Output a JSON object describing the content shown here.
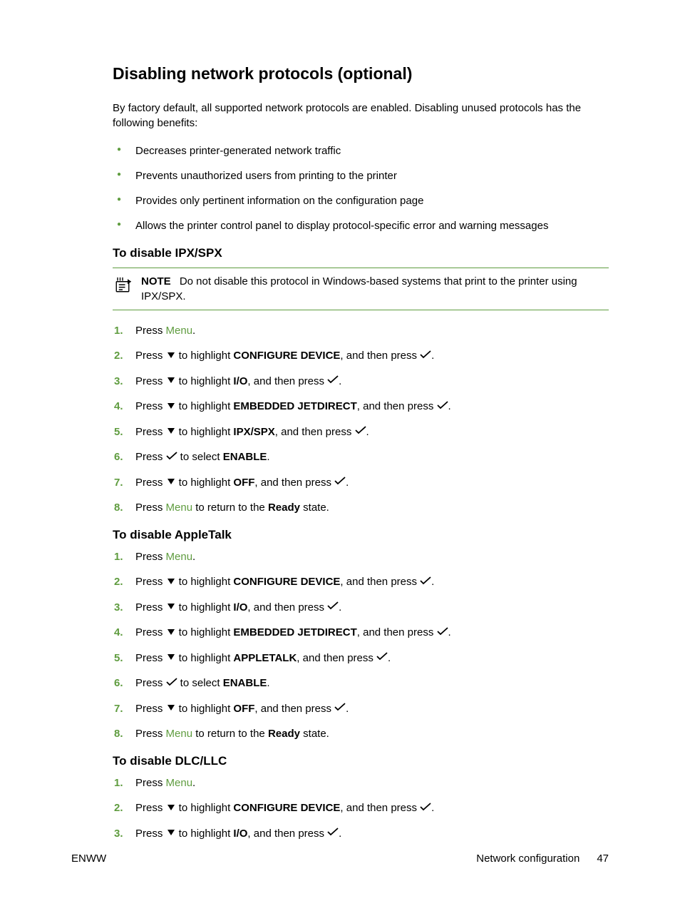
{
  "heading": "Disabling network protocols (optional)",
  "intro": "By factory default, all supported network protocols are enabled. Disabling unused protocols has the following benefits:",
  "bullets": [
    "Decreases printer-generated network traffic",
    "Prevents unauthorized users from printing to the printer",
    "Provides only pertinent information on the configuration page",
    "Allows the printer control panel to display protocol-specific error and warning messages"
  ],
  "section1": {
    "title": "To disable IPX/SPX",
    "note_label": "NOTE",
    "note_text": "Do not disable this protocol in Windows-based systems that print to the printer using IPX/SPX.",
    "target": "IPX/SPX"
  },
  "section2": {
    "title": "To disable AppleTalk",
    "target": "APPLETALK"
  },
  "section3": {
    "title": "To disable DLC/LLC"
  },
  "words": {
    "press": "Press ",
    "menu": "Menu",
    "period": ".",
    "to_highlight": " to highlight ",
    "and_then_press": ", and then press ",
    "to_select": " to select ",
    "configure_device": "CONFIGURE DEVICE",
    "io": "I/O",
    "embedded_jetdirect": "EMBEDDED JETDIRECT",
    "enable": "ENABLE",
    "off": "OFF",
    "to_return": " to return to the ",
    "ready": "Ready",
    "state": " state."
  },
  "footer": {
    "left": "ENWW",
    "right_label": "Network configuration",
    "page": "47"
  }
}
